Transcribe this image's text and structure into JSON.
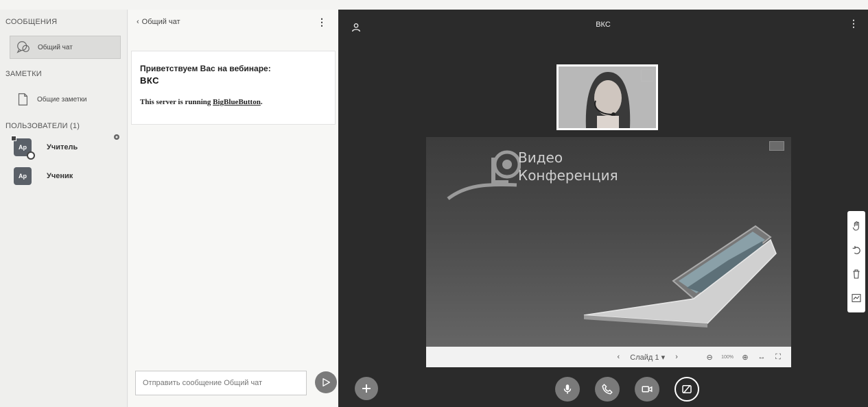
{
  "sidebar": {
    "messages_title": "СООБЩЕНИЯ",
    "public_chat": "Общий чат",
    "notes_title": "ЗАМЕТКИ",
    "shared_notes": "Общие заметки",
    "users_title": "ПОЛЬЗОВАТЕЛИ (1)",
    "users": [
      {
        "initials": "Ар",
        "name": "Учитель"
      },
      {
        "initials": "Ар",
        "name": "Ученик"
      }
    ]
  },
  "chat": {
    "back_label": "Общий чат",
    "welcome_line1": "Приветствуем Вас на вебинаре:",
    "welcome_line2": "ВКС",
    "welcome_line3_prefix": "This server is running ",
    "welcome_link": "BigBlueButton",
    "welcome_line3_suffix": ".",
    "input_placeholder": "Отправить сообщение Общий чат"
  },
  "stage": {
    "title": "ВКС",
    "slide": {
      "title_line1": "Видео",
      "title_line2": "Конференция"
    },
    "slide_toolbar": {
      "slide_label": "Слайд 1",
      "zoom": "100%"
    }
  },
  "icons": {
    "chat": "chat-icon",
    "notes": "notes-icon",
    "gear": "gear-icon",
    "send": "send-icon",
    "user": "user-icon",
    "hand": "hand-icon",
    "undo": "undo-icon",
    "trash": "trash-icon",
    "whiteboard": "whiteboard-icon",
    "plus": "plus-icon",
    "mic": "microphone-icon",
    "phone": "phone-icon",
    "camera": "camera-icon",
    "screenshare": "screenshare-off-icon"
  },
  "colors": {
    "stage_bg": "#2b2b2b",
    "sidebar_bg": "#efefed",
    "button_gray": "#7a7a7a"
  }
}
